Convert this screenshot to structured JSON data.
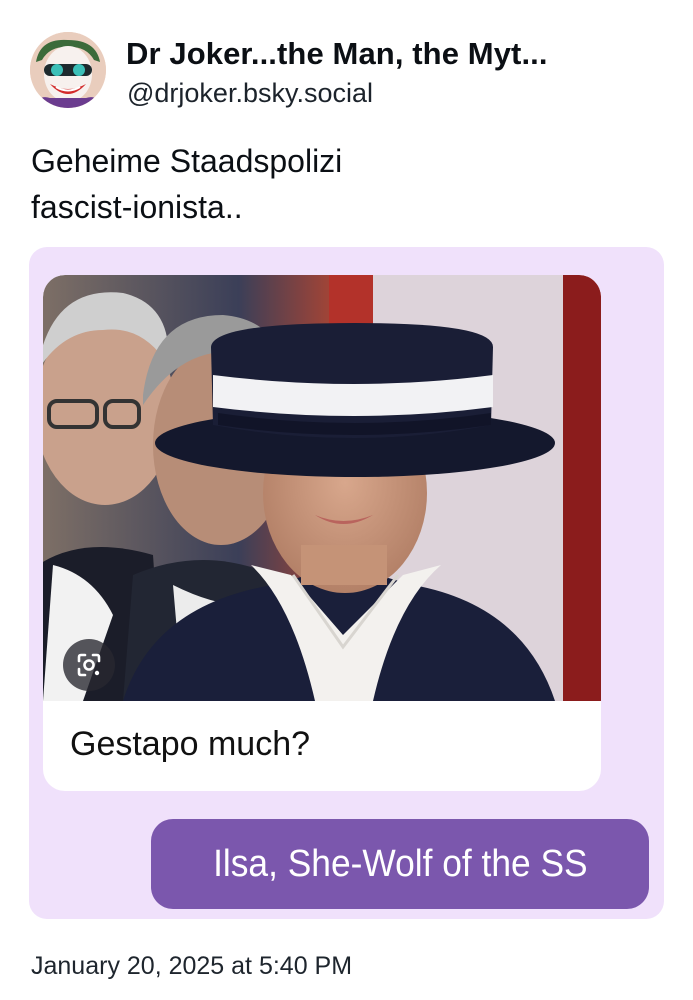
{
  "author": {
    "display_name": "Dr Joker...the Man, the Myt...",
    "handle": "@drjoker.bsky.social",
    "avatar_icon": "joker-avatar-icon"
  },
  "post": {
    "text_lines": [
      "Geheime Staadspolizi",
      "fascist-ionista.."
    ],
    "timestamp": "January 20, 2025 at 5:40 PM"
  },
  "embed": {
    "background_color": "#f0e1fb",
    "received_message": {
      "image_icon": "lens-search-icon",
      "caption": "Gestapo much?"
    },
    "sent_message": {
      "text": "Ilsa, She-Wolf of the SS",
      "color": "#7b57ad"
    }
  }
}
